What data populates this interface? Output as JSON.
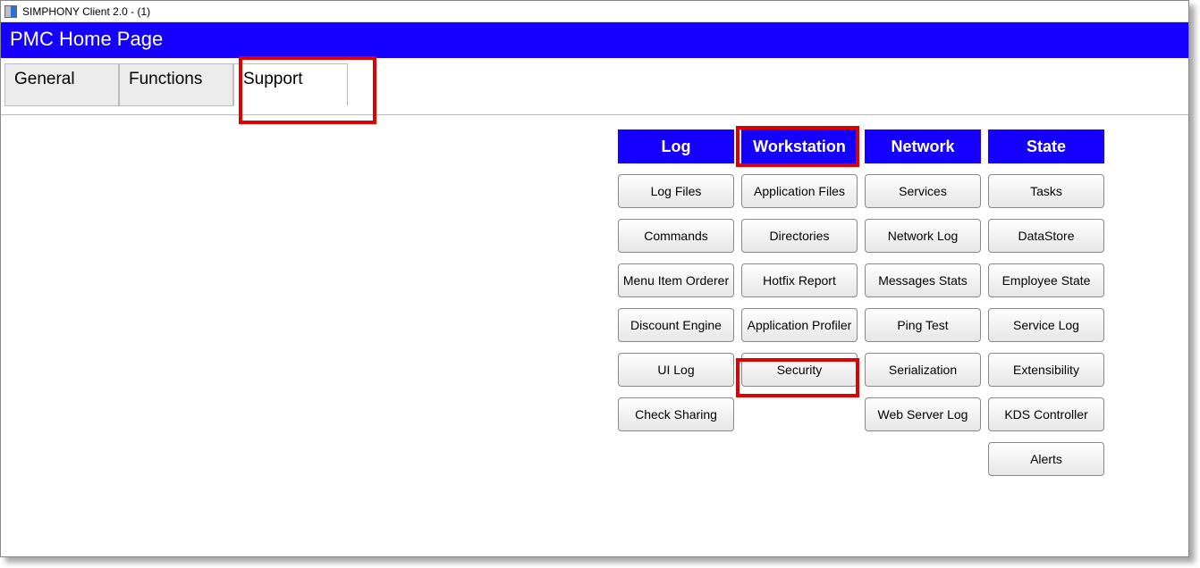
{
  "window": {
    "title": "SIMPHONY Client 2.0 - (1)"
  },
  "header": {
    "title": "PMC Home Page"
  },
  "tabs": [
    {
      "label": "General",
      "active": false
    },
    {
      "label": "Functions",
      "active": false
    },
    {
      "label": "Support",
      "active": true
    }
  ],
  "columns": {
    "log": {
      "header": "Log"
    },
    "workstation": {
      "header": "Workstation"
    },
    "network": {
      "header": "Network"
    },
    "state": {
      "header": "State"
    }
  },
  "rows": [
    {
      "log": "Log Files",
      "workstation": "Application Files",
      "network": "Services",
      "state": "Tasks"
    },
    {
      "log": "Commands",
      "workstation": "Directories",
      "network": "Network Log",
      "state": "DataStore"
    },
    {
      "log": "Menu Item Orderer",
      "workstation": "Hotfix Report",
      "network": "Messages Stats",
      "state": "Employee State"
    },
    {
      "log": "Discount Engine",
      "workstation": "Application Profiler",
      "network": "Ping Test",
      "state": "Service Log"
    },
    {
      "log": "UI Log",
      "workstation": "Security",
      "network": "Serialization",
      "state": "Extensibility"
    },
    {
      "log": "Check Sharing",
      "workstation": "",
      "network": "Web Server Log",
      "state": "KDS Controller"
    },
    {
      "log": "",
      "workstation": "",
      "network": "",
      "state": "Alerts"
    }
  ]
}
